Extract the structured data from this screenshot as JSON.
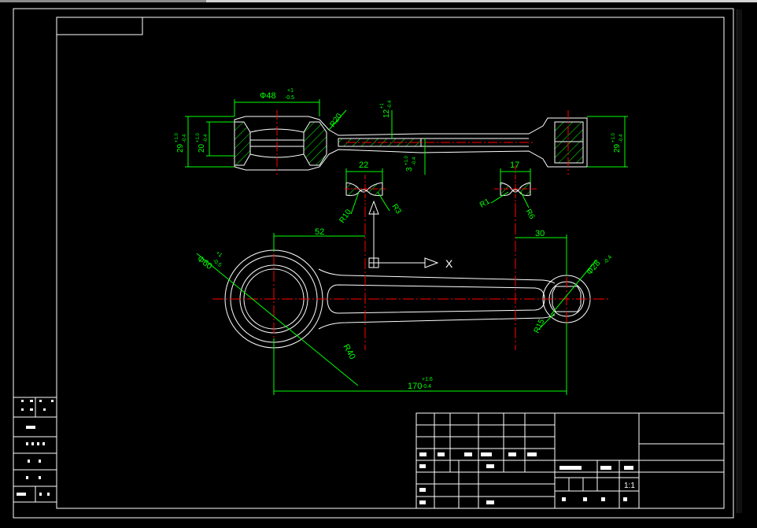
{
  "drawing": {
    "colors": {
      "background": "#000000",
      "frame": "#ffffff",
      "outline": "#ffffff",
      "dimension": "#00ff00",
      "centerline": "#ff0000",
      "hatch": "#00ff00"
    },
    "section_view": {
      "dims": {
        "bore_big": "48",
        "bore_big_tol_up": "+1",
        "bore_big_tol_dn": "-0.5",
        "r20": "R20",
        "web_thick": "12",
        "web_tol_up": "+1",
        "web_tol_dn": "-0.4",
        "left_height": "29",
        "left_height_tol_up": "+1.0",
        "left_height_tol_dn": "-0.4",
        "left_inner": "20",
        "left_inner_tol_up": "+1.0",
        "left_inner_tol_dn": "-0.4",
        "mid_thick": "3",
        "mid_tol_up": "+1.0",
        "mid_tol_dn": "-0.4",
        "right_height": "29",
        "right_height_tol_up": "+1.0",
        "right_height_tol_dn": "-0.4"
      }
    },
    "cross_sections": {
      "left": {
        "width": "22",
        "r_left": "R10",
        "r_right": "R3"
      },
      "right": {
        "width": "17",
        "r_left": "R1",
        "r_right": "R6"
      }
    },
    "plan_view": {
      "dim_52": "52",
      "dim_30": "30",
      "big_dia": "Ф60",
      "big_dia_tol_up": "+1",
      "big_dia_tol_dn": "-0.5",
      "small_dia": "Ф28",
      "small_dia_tol": "-0.4",
      "r40": "R40",
      "r15": "R15",
      "length": "170",
      "length_tol_up": "+1.6",
      "length_tol_dn": "-0.4"
    },
    "ucs": {
      "x_label": "X"
    },
    "title_block": {
      "scale": "1:1"
    }
  }
}
